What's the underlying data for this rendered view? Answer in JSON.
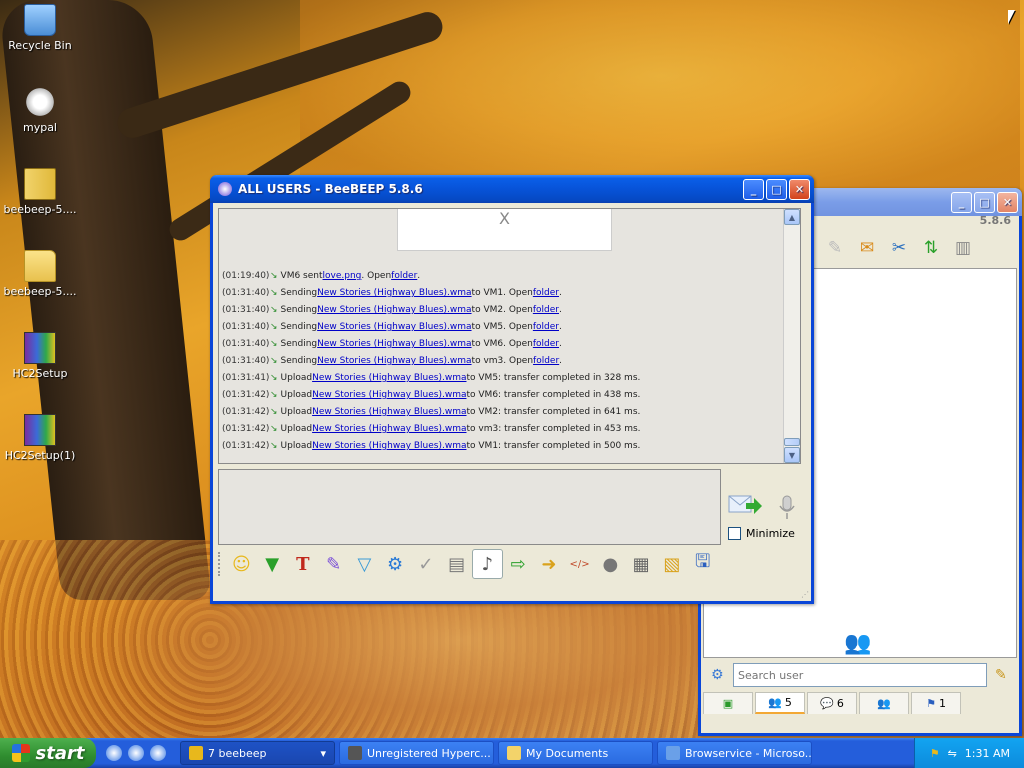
{
  "desktop": {
    "icons": [
      {
        "label": "Recycle Bin",
        "icon": "recycle-bin-icon"
      },
      {
        "label": "mypal",
        "icon": "mypal-icon"
      },
      {
        "label": "beebeep-5....",
        "icon": "zip-folder-icon"
      },
      {
        "label": "beebeep-5....",
        "icon": "folder-icon"
      },
      {
        "label": "HC2Setup",
        "icon": "installer-icon"
      },
      {
        "label": "HC2Setup(1)",
        "icon": "installer-icon"
      }
    ]
  },
  "chat_window": {
    "title": "ALL USERS - BeeBEEP 5.8.6",
    "preview_char": "X",
    "log": [
      {
        "time": "(01:19:40)",
        "pre": "VM6 sent ",
        "link": "love.png",
        "mid": ". Open ",
        "link2": "folder",
        "post": "."
      },
      {
        "time": "(01:31:40)",
        "pre": "Sending ",
        "link": "New Stories (Highway Blues).wma",
        "mid": " to VM1. Open ",
        "link2": "folder",
        "post": "."
      },
      {
        "time": "(01:31:40)",
        "pre": "Sending ",
        "link": "New Stories (Highway Blues).wma",
        "mid": " to VM2. Open ",
        "link2": "folder",
        "post": "."
      },
      {
        "time": "(01:31:40)",
        "pre": "Sending ",
        "link": "New Stories (Highway Blues).wma",
        "mid": " to VM5. Open ",
        "link2": "folder",
        "post": "."
      },
      {
        "time": "(01:31:40)",
        "pre": "Sending ",
        "link": "New Stories (Highway Blues).wma",
        "mid": " to VM6. Open ",
        "link2": "folder",
        "post": "."
      },
      {
        "time": "(01:31:40)",
        "pre": "Sending ",
        "link": "New Stories (Highway Blues).wma",
        "mid": " to vm3. Open ",
        "link2": "folder",
        "post": "."
      },
      {
        "time": "(01:31:41)",
        "pre": "Upload ",
        "link": "New Stories (Highway Blues).wma",
        "mid": " to VM5: transfer completed in 328 ms.",
        "link2": "",
        "post": ""
      },
      {
        "time": "(01:31:42)",
        "pre": "Upload ",
        "link": "New Stories (Highway Blues).wma",
        "mid": " to VM6: transfer completed in 438 ms.",
        "link2": "",
        "post": ""
      },
      {
        "time": "(01:31:42)",
        "pre": "Upload ",
        "link": "New Stories (Highway Blues).wma",
        "mid": " to VM2: transfer completed in 641 ms.",
        "link2": "",
        "post": ""
      },
      {
        "time": "(01:31:42)",
        "pre": "Upload ",
        "link": "New Stories (Highway Blues).wma",
        "mid": " to vm3: transfer completed in 453 ms.",
        "link2": "",
        "post": ""
      },
      {
        "time": "(01:31:42)",
        "pre": "Upload ",
        "link": "New Stories (Highway Blues).wma",
        "mid": " to VM1: transfer completed in 500 ms.",
        "link2": "",
        "post": ""
      }
    ],
    "minimize_label": "Minimize",
    "toolbar_icons": [
      "emoticon-icon",
      "save-icon",
      "font-icon",
      "color-icon",
      "filter-icon",
      "settings-icon",
      "read-icon",
      "text-icon",
      "music-note-icon",
      "send-file-icon",
      "send-folder-icon",
      "html-icon",
      "record-icon",
      "screenshot-icon",
      "note-icon",
      "floppy-icon"
    ]
  },
  "main_window": {
    "version": "5.8.6",
    "search": {
      "placeholder": "Search user"
    },
    "tabs": [
      {
        "icon": "monitor-icon",
        "count": ""
      },
      {
        "icon": "users-icon",
        "count": "5"
      },
      {
        "icon": "chat-icon",
        "count": "6"
      },
      {
        "icon": "group-icon",
        "count": ""
      },
      {
        "icon": "share-icon",
        "count": "1"
      }
    ]
  },
  "taskbar": {
    "start_label": "start",
    "buttons": [
      {
        "label": "7 beebeep",
        "icon": "beebeep-icon"
      },
      {
        "label": "Unregistered Hyperc...",
        "icon": "hypercam-icon"
      },
      {
        "label": "My Documents",
        "icon": "folder-icon"
      },
      {
        "label": "Browservice - Microso...",
        "icon": "browser-icon"
      }
    ],
    "clock": "1:31 AM"
  }
}
